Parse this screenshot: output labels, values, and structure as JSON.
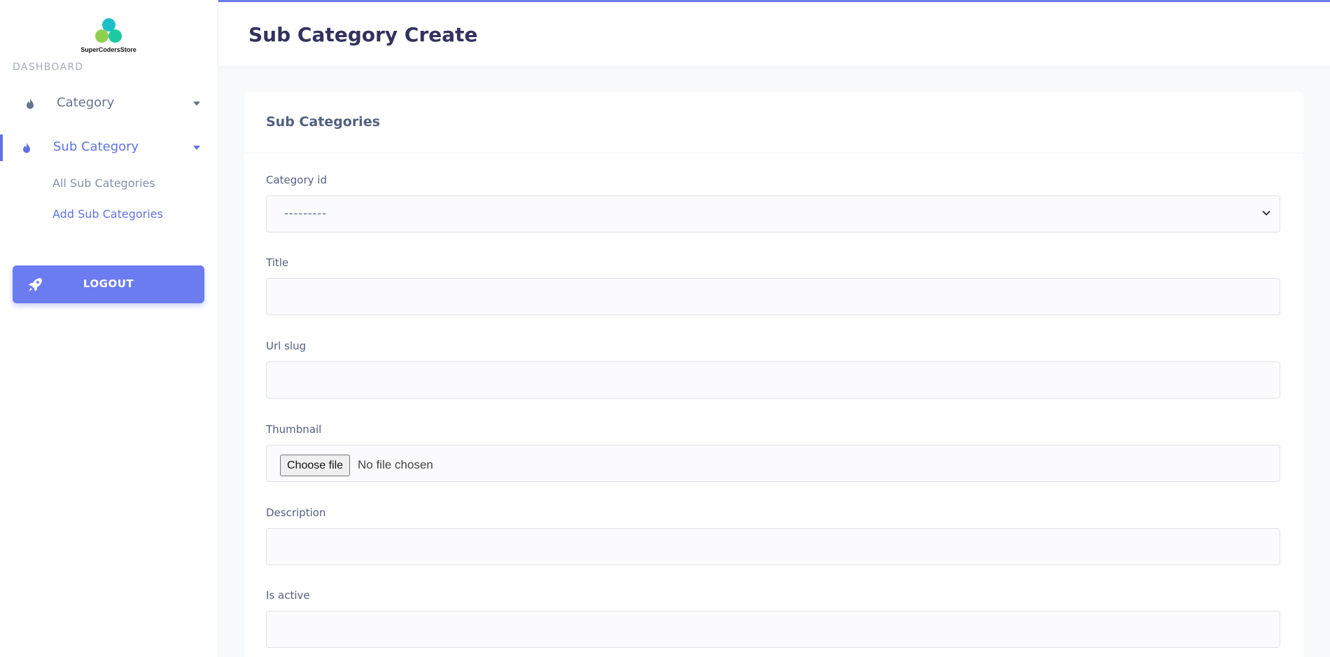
{
  "app": {
    "logo_text": "SuperCodersStore"
  },
  "sidebar": {
    "section_label": "DASHBOARD",
    "items": [
      {
        "label": "Category",
        "icon": "fire-icon",
        "active": false
      },
      {
        "label": "Sub Category",
        "icon": "fire-icon",
        "active": true
      }
    ],
    "subitems": [
      {
        "label": "All Sub Categories",
        "active": false
      },
      {
        "label": "Add Sub Categories",
        "active": true
      }
    ],
    "logout_label": "LOGOUT"
  },
  "header": {
    "title": "Sub Category Create"
  },
  "form": {
    "card_title": "Sub Categories",
    "category_label": "Category id",
    "category_value": "---------",
    "title_label": "Title",
    "title_value": "",
    "slug_label": "Url slug",
    "slug_value": "",
    "thumbnail_label": "Thumbnail",
    "thumbnail_button": "Choose file",
    "thumbnail_status": "No file chosen",
    "description_label": "Description",
    "description_value": "",
    "active_label": "Is active",
    "active_value": ""
  },
  "colors": {
    "accent": "#5e72e4",
    "logout_bg": "#6b7cf0",
    "text_muted": "#67748e"
  }
}
